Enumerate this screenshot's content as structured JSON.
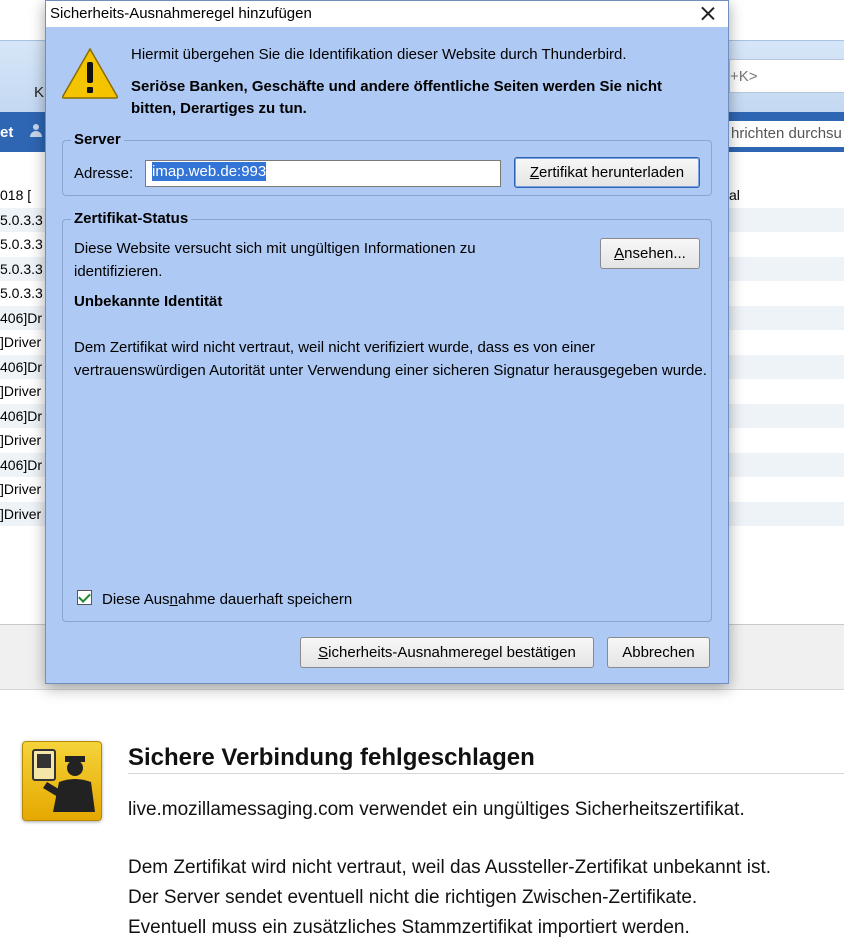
{
  "background_app": {
    "toolbar_letter": "K",
    "shortcut_hint": "+K>",
    "tab_label": "et",
    "search_placeholder": "hrichten durchsu",
    "list_rows": [
      {
        "left": "018 [",
        "right": "al"
      },
      {
        "left": "5.0.3.3",
        "right": ""
      },
      {
        "left": "5.0.3.3",
        "right": ""
      },
      {
        "left": "5.0.3.3",
        "right": ""
      },
      {
        "left": "5.0.3.3",
        "right": ""
      },
      {
        "left": "406]Dr",
        "right": ""
      },
      {
        "left": "]Driver",
        "right": ""
      },
      {
        "left": "406]Dr",
        "right": ""
      },
      {
        "left": "]Driver",
        "right": ""
      },
      {
        "left": "406]Dr",
        "right": ""
      },
      {
        "left": "]Driver",
        "right": ""
      },
      {
        "left": "406]Dr",
        "right": ""
      },
      {
        "left": "]Driver",
        "right": ""
      },
      {
        "left": "]Driver",
        "right": ""
      }
    ]
  },
  "error_page": {
    "icon": "security-officer-icon",
    "title": "Sichere Verbindung fehlgeschlagen",
    "line1": "live.mozillamessaging.com verwendet ein ungültiges Sicherheitszertifikat.",
    "line2": "Dem Zertifikat wird nicht vertraut, weil das Aussteller-Zertifikat unbekannt ist.",
    "line3": "Der Server sendet eventuell nicht die richtigen Zwischen-Zertifikate.",
    "line4": "Eventuell muss ein zusätzliches Stammzertifikat importiert werden."
  },
  "dialog": {
    "title": "Sicherheits-Ausnahmeregel hinzufügen",
    "warning_icon": "warning-triangle-icon",
    "intro": "Hiermit übergehen Sie die Identifikation dieser Website durch Thunderbird.",
    "intro_bold": "Seriöse Banken, Geschäfte und andere öffentliche Seiten werden Sie nicht bitten, Derartiges zu tun.",
    "server": {
      "legend": "Server",
      "address_label": "Adresse:",
      "address_value": "imap.web.de:993",
      "download_button": {
        "access_key": "Z",
        "rest": "ertifikat herunterladen"
      }
    },
    "cert_status": {
      "legend": "Zertifikat-Status",
      "description": "Diese Website versucht sich mit ungültigen Informationen zu identifizieren.",
      "view_button": {
        "access_key": "A",
        "rest": "nsehen..."
      },
      "heading": "Unbekannte Identität",
      "details": "Dem Zertifikat wird nicht vertraut, weil nicht verifiziert wurde, dass es von einer vertrauenswürdigen Autorität unter Verwendung einer sicheren Signatur herausgegeben wurde."
    },
    "permanent_checkbox": {
      "checked": true,
      "before": "Diese Aus",
      "access_key": "n",
      "after": "ahme dauerhaft speichern"
    },
    "confirm_button": {
      "access_key": "S",
      "rest": "icherheits-Ausnahmeregel bestätigen"
    },
    "cancel_button": "Abbrechen"
  },
  "colors": {
    "dialog_bg": "#aec9f3",
    "selection": "#3375d6",
    "tabbar": "#2f66b3",
    "warning_yellow": "#f5c400"
  }
}
